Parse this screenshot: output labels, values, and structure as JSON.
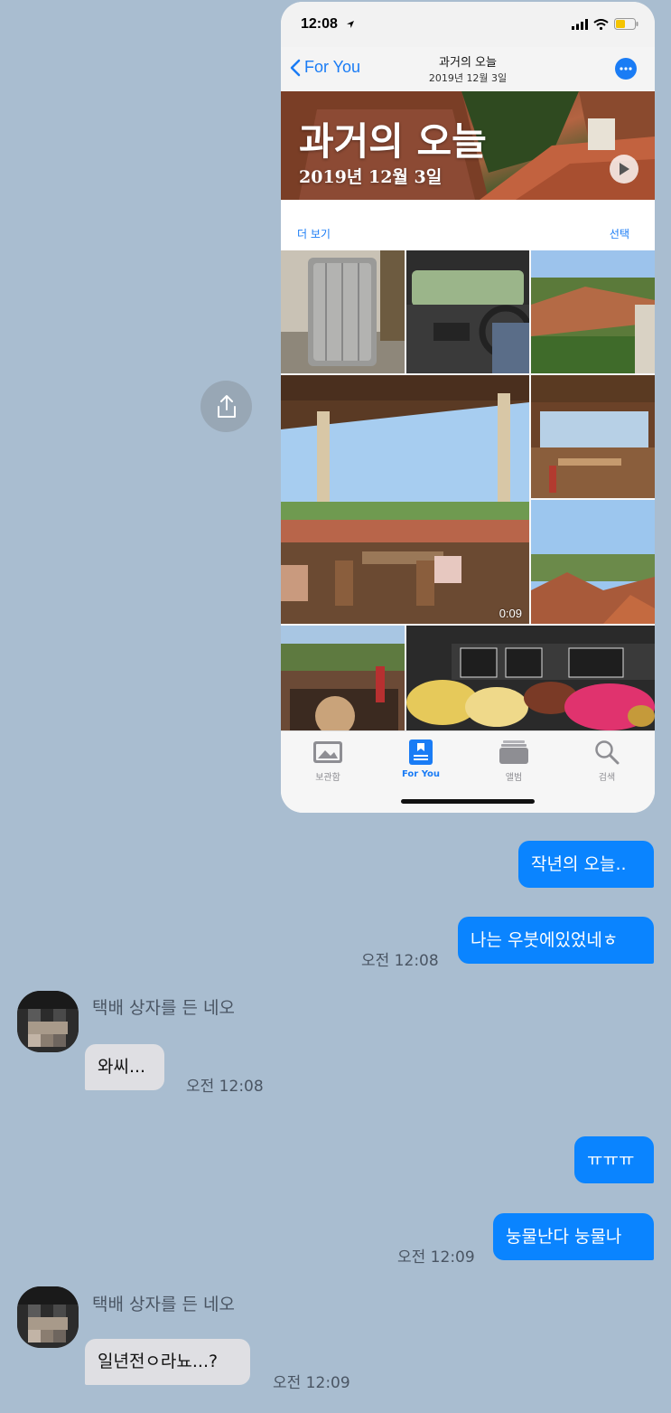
{
  "screenshot": {
    "status_time": "12:08",
    "nav": {
      "back_label": "For You",
      "title": "과거의 오늘",
      "subtitle": "2019년 12월 3일"
    },
    "hero": {
      "title": "과거의 오늘",
      "date": "2019년 12월 3일"
    },
    "section": {
      "see_more": "더 보기",
      "select": "선택"
    },
    "video_duration": "0:09",
    "tabs": [
      {
        "label": "보관함",
        "icon": "photos-library-icon"
      },
      {
        "label": "For You",
        "icon": "for-you-icon"
      },
      {
        "label": "앨범",
        "icon": "albums-icon"
      },
      {
        "label": "검색",
        "icon": "search-icon"
      }
    ],
    "accent_color": "#1a7cf5"
  },
  "chat": {
    "messages": [
      {
        "from": "me",
        "text": "작년의 오늘.."
      },
      {
        "from": "me",
        "text": "나는 우붓에있었네ㅎ",
        "time": "오전 12:08"
      },
      {
        "from": "them",
        "sender": "택배 상자를 든 네오",
        "text": "와씨...",
        "time": "오전 12:08"
      },
      {
        "from": "me",
        "text": "ㅠㅠㅠ"
      },
      {
        "from": "me",
        "text": "눙물난다 눙물나",
        "time": "오전 12:09"
      },
      {
        "from": "them",
        "sender": "택배 상자를 든 네오",
        "text": "일년전ㅇ라뇨...?",
        "time": "오전 12:09"
      }
    ],
    "bubble_color_me": "#0a84ff",
    "bubble_color_them": "#dfdfe3",
    "background": "#a9bdd0"
  }
}
